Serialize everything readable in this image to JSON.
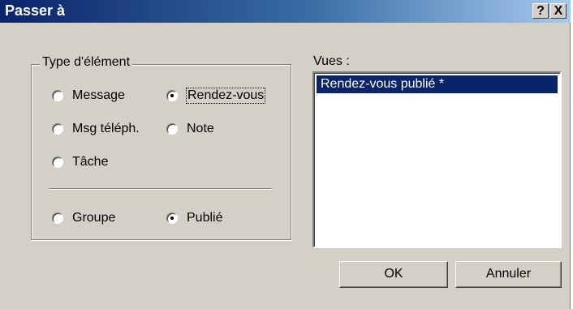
{
  "window": {
    "title": "Passer à",
    "help_label": "?",
    "close_label": "X"
  },
  "item_type": {
    "legend": "Type d'élément",
    "options": [
      {
        "label": "Message",
        "selected": false
      },
      {
        "label": "Rendez-vous",
        "selected": true
      },
      {
        "label": "Msg téléph.",
        "selected": false
      },
      {
        "label": "Note",
        "selected": false
      },
      {
        "label": "Tâche",
        "selected": false
      }
    ],
    "scope": [
      {
        "label": "Groupe",
        "selected": false
      },
      {
        "label": "Publié",
        "selected": true
      }
    ]
  },
  "views": {
    "label": "Vues :",
    "items": [
      "Rendez-vous publié *"
    ],
    "selected_index": 0
  },
  "buttons": {
    "ok": "OK",
    "cancel": "Annuler"
  },
  "colors": {
    "face": "#d4d0c8",
    "title_active": "#0a246a",
    "selection": "#0a246a"
  }
}
